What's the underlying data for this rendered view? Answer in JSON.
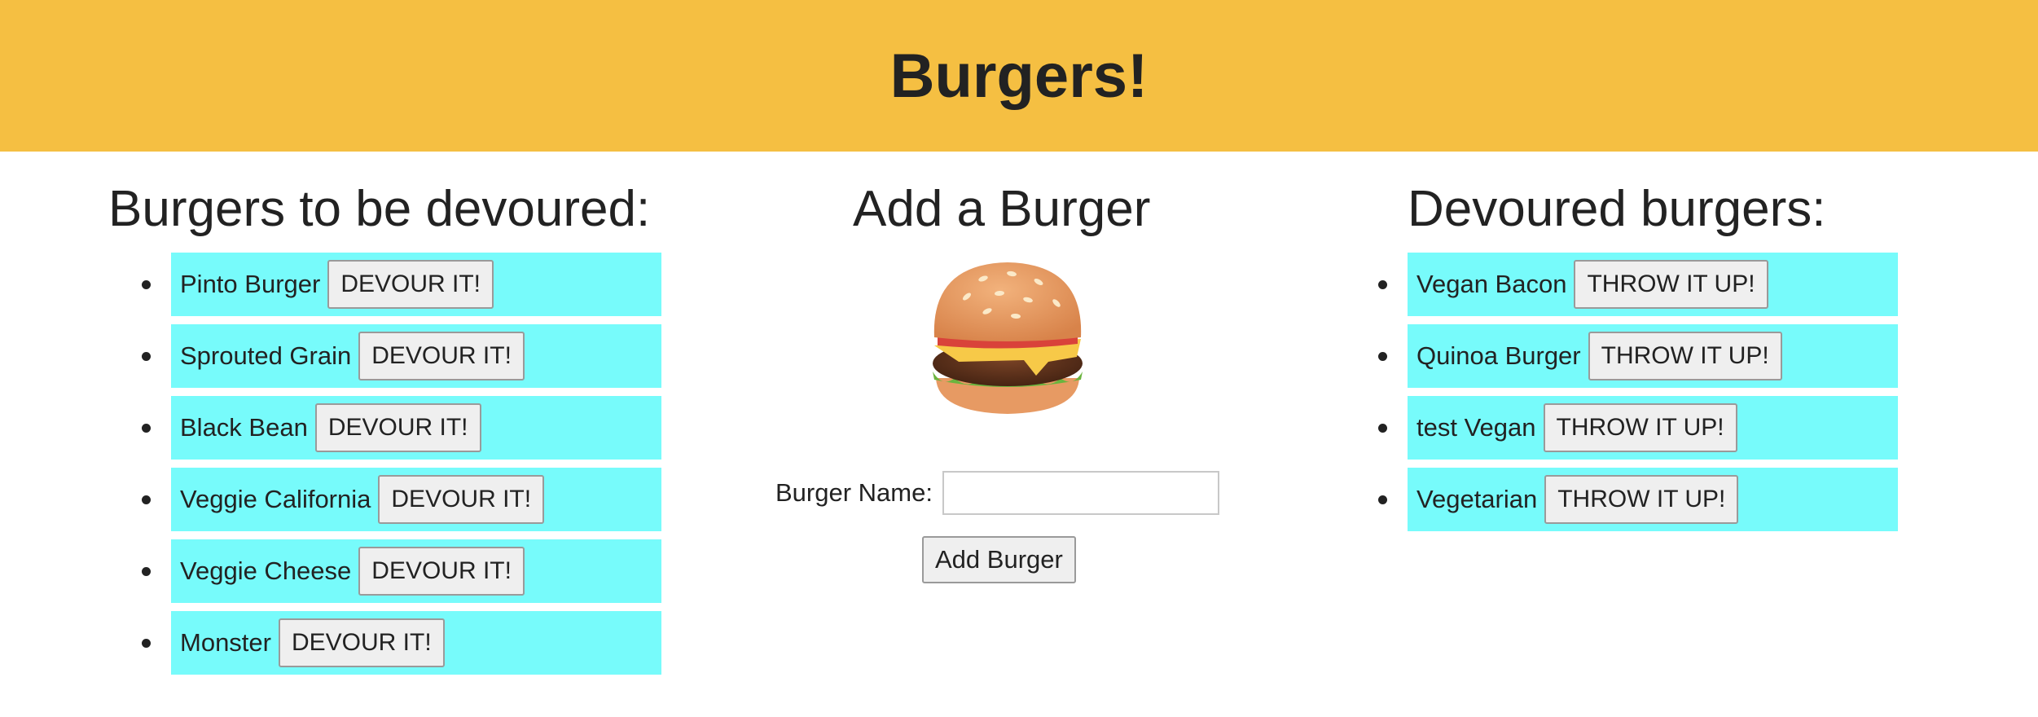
{
  "header": {
    "title": "Burgers!"
  },
  "to_devour": {
    "heading": "Burgers to be devoured:",
    "button_label": "DEVOUR IT!",
    "items": [
      {
        "name": "Pinto Burger"
      },
      {
        "name": "Sprouted Grain"
      },
      {
        "name": "Black Bean"
      },
      {
        "name": "Veggie California"
      },
      {
        "name": "Veggie Cheese"
      },
      {
        "name": "Monster"
      }
    ]
  },
  "add": {
    "heading": "Add a Burger",
    "image_icon": "hamburger-icon",
    "name_label": "Burger Name:",
    "name_value": "",
    "button_label": "Add Burger"
  },
  "devoured": {
    "heading": "Devoured burgers:",
    "button_label": "THROW IT UP!",
    "items": [
      {
        "name": "Vegan Bacon"
      },
      {
        "name": "Quinoa Burger"
      },
      {
        "name": "test Vegan"
      },
      {
        "name": "Vegetarian"
      }
    ]
  },
  "colors": {
    "header_bg": "#f5bf42",
    "item_bg": "#77fbfb"
  }
}
